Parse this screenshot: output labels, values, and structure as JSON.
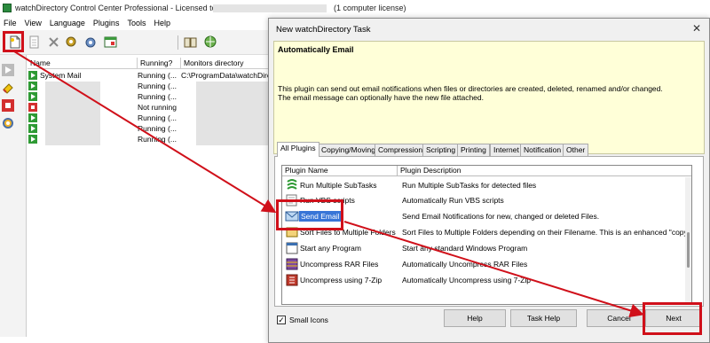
{
  "window": {
    "title": "watchDirectory Control Center Professional - Licensed to",
    "license": "(1 computer license)"
  },
  "menu": [
    "File",
    "View",
    "Language",
    "Plugins",
    "Tools",
    "Help"
  ],
  "tasks": {
    "columns": [
      "Name",
      "Running?",
      "Monitors directory"
    ],
    "rows": [
      {
        "name": "System Mail",
        "running": "Running (...",
        "dir": "C:\\ProgramData\\watchDirect",
        "status": "green"
      },
      {
        "name": "",
        "running": "Running (...",
        "dir": "",
        "status": "green"
      },
      {
        "name": "",
        "running": "Running (...",
        "dir": "",
        "status": "green"
      },
      {
        "name": "",
        "running": "Not running",
        "dir": "",
        "status": "red"
      },
      {
        "name": "",
        "running": "Running (...",
        "dir": "",
        "status": "green"
      },
      {
        "name": "",
        "running": "Running (...",
        "dir": "",
        "status": "green"
      },
      {
        "name": "",
        "running": "Running (...",
        "dir": "",
        "status": "green"
      }
    ]
  },
  "dialog": {
    "title": "New watchDirectory Task",
    "close": "✕",
    "heading": "Automatically Email",
    "line1": "This plugin can send out email notifications when files or directories are created, deleted, renamed and/or changed.",
    "line2": "The email message can optionally have the new file attached.",
    "tabs": [
      "All Plugins",
      "Copying/Moving",
      "Compression",
      "Scripting",
      "Printing",
      "Internet",
      "Notification",
      "Other"
    ],
    "plugin_columns": [
      "Plugin Name",
      "Plugin Description"
    ],
    "plugins": [
      {
        "name": "Run Multiple SubTasks",
        "desc": "Run Multiple SubTasks for detected files",
        "icon": "subtasks-icon"
      },
      {
        "name": "Run VBS scripts",
        "desc": "Automatically Run VBS scripts",
        "icon": "script-icon"
      },
      {
        "name": "Send Email",
        "desc": "Send Email Notifications for new, changed or deleted Files.",
        "icon": "email-icon"
      },
      {
        "name": "Sort Files to Multiple Folders",
        "desc": "Sort Files to Multiple Folders depending on their Filename. This is an enhanced \"copy files\".",
        "icon": "sort-icon"
      },
      {
        "name": "Start any Program",
        "desc": "Start any standard Windows Program",
        "icon": "program-icon"
      },
      {
        "name": "Uncompress RAR Files",
        "desc": "Automatically Uncompress RAR Files",
        "icon": "rar-icon"
      },
      {
        "name": "Uncompress using 7-Zip",
        "desc": "Automatically Uncompress using 7-Zip",
        "icon": "zip-icon"
      }
    ],
    "small_icons_label": "Small Icons",
    "small_icons_checked": "✓",
    "buttons": {
      "help": "Help",
      "task_help": "Task Help",
      "cancel": "Cancel",
      "next": "Next"
    }
  },
  "right_edge": [
    "r",
    "ie",
    "ir",
    "1",
    "ts",
    "ie",
    "ie"
  ],
  "colors": {
    "highlight": "#d0101a",
    "selection": "#3875d7",
    "info_bg": "#ffffd8"
  }
}
